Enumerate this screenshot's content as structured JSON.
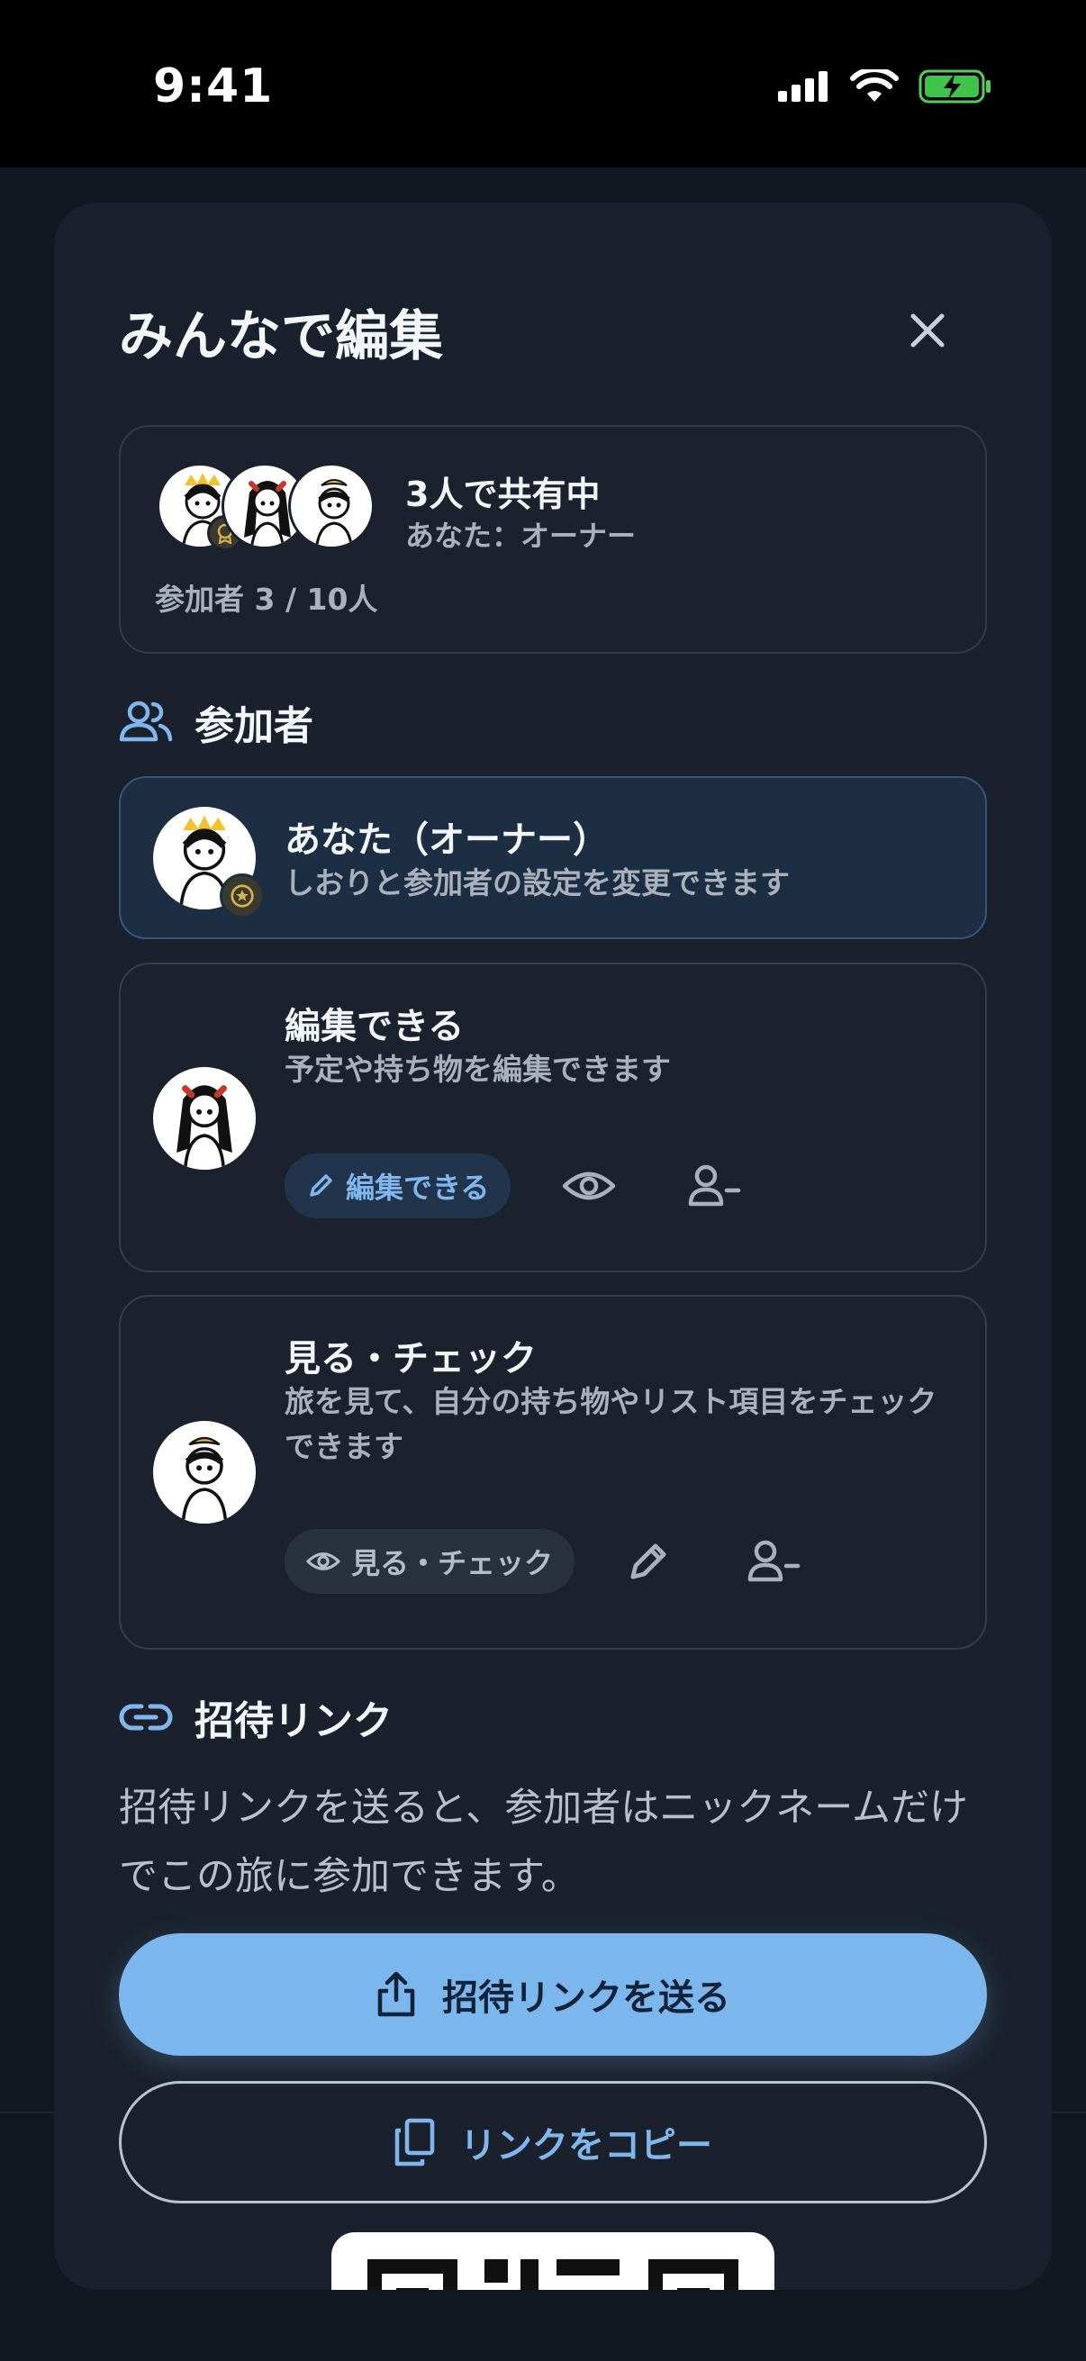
{
  "status_bar": {
    "time": "9:41"
  },
  "sheet": {
    "title": "みんなで編集",
    "summary": {
      "title": "3人で共有中",
      "role": "あなた：オーナー",
      "count": "参加者 3 / 10人"
    },
    "participants": {
      "heading": "参加者",
      "owner": {
        "name": "あなた（オーナー）",
        "desc": "しおりと参加者の設定を変更できます"
      },
      "editor": {
        "name": "編集できる",
        "desc": "予定や持ち物を編集できます",
        "chip": "編集できる"
      },
      "viewer": {
        "name": "見る・チェック",
        "desc": "旅を見て、自分の持ち物やリスト項目をチェックできます",
        "chip": "見る・チェック"
      }
    },
    "invite": {
      "heading": "招待リンク",
      "desc": "招待リンクを送ると、参加者はニックネームだけでこの旅に参加できます。",
      "send_label": "招待リンクを送る",
      "copy_label": "リンクをコピー"
    }
  },
  "colors": {
    "accent": "#7bb6ec",
    "background": "#1a212c",
    "owner_highlight": "#1d2d42"
  }
}
